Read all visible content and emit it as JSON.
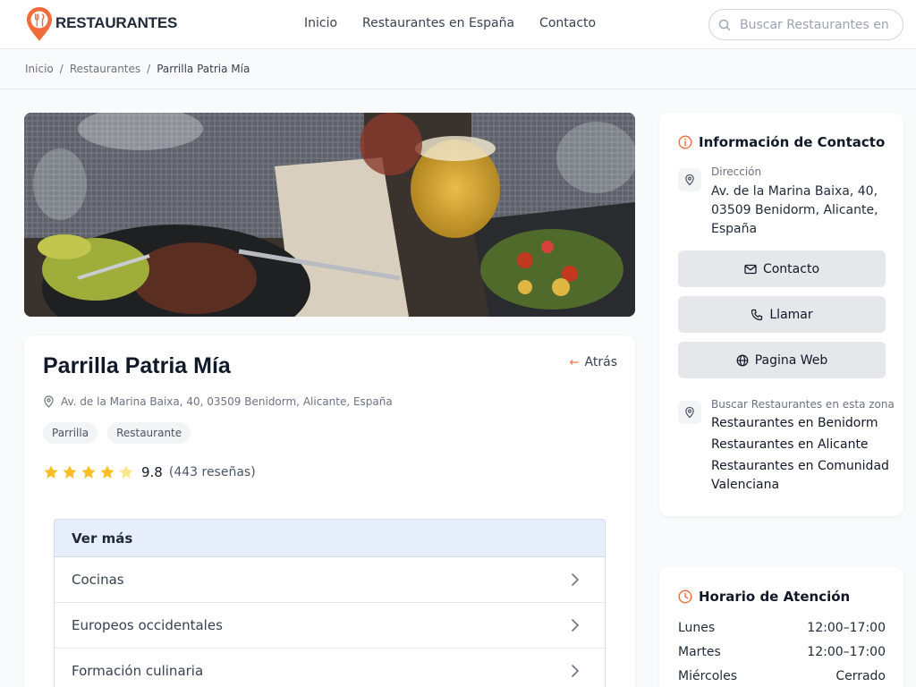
{
  "header": {
    "brand": "RESTAURANTES",
    "nav": [
      "Inicio",
      "Restaurantes en España",
      "Contacto"
    ],
    "search_placeholder": "Buscar Restaurantes en"
  },
  "breadcrumb": {
    "items": [
      "Inicio",
      "Restaurantes"
    ],
    "separator": "/",
    "current": "Parrilla Patria Mía"
  },
  "restaurant": {
    "name": "Parrilla Patria Mía",
    "back_label": "Atrás",
    "address": "Av. de la Marina Baixa, 40, 03509 Benidorm, Alicante, España",
    "tags": [
      "Parrilla",
      "Restaurante"
    ],
    "rating": {
      "stars_filled": 4,
      "stars_total": 5,
      "score": "9.8",
      "reviews": "(443 reseñas)"
    }
  },
  "ver_mas": {
    "title": "Ver más",
    "items": [
      "Cocinas",
      "Europeos occidentales",
      "Formación culinaria"
    ]
  },
  "contact": {
    "title": "Información de Contacto",
    "address_label": "Dirección",
    "address": "Av. de la Marina Baixa, 40, 03509 Benidorm, Alicante, España",
    "buttons": {
      "contact": "Contacto",
      "call": "Llamar",
      "web": "Pagina Web"
    },
    "zone_label": "Buscar Restaurantes en esta zona",
    "zone_links": [
      "Restaurantes en Benidorm",
      "Restaurantes en Alicante",
      "Restaurantes en Comunidad Valenciana"
    ]
  },
  "hours": {
    "title": "Horario de Atención",
    "rows": [
      {
        "day": "Lunes",
        "time": "12:00–17:00"
      },
      {
        "day": "Martes",
        "time": "12:00–17:00"
      },
      {
        "day": "Miércoles",
        "time": "Cerrado"
      }
    ]
  },
  "colors": {
    "accent": "#f26c3b",
    "star": "#fbbf24",
    "star_empty": "#fde68a",
    "ver_mas_header": "#e6eefb"
  }
}
